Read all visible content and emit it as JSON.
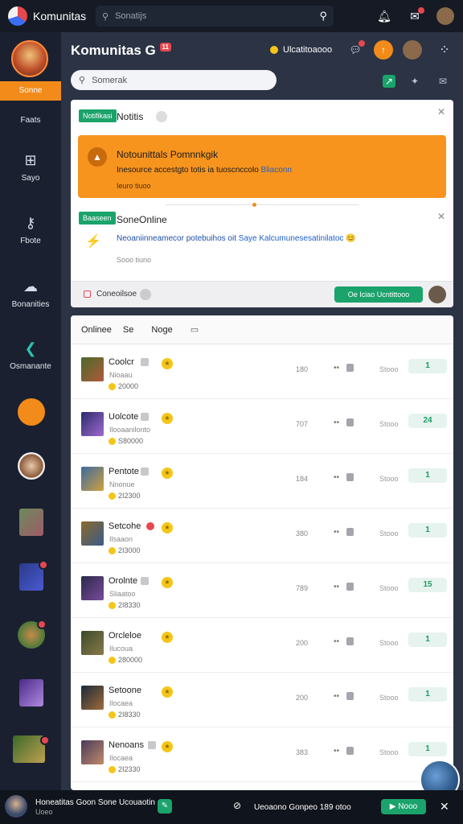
{
  "topbar": {
    "brand": "Komunitas",
    "search_placeholder": "Sonatijs"
  },
  "sidebar": {
    "items": [
      {
        "label": "Sonne"
      },
      {
        "label": "Faats"
      },
      {
        "label": "Sayo"
      },
      {
        "label": "Fbote"
      },
      {
        "label": "Bonanities"
      },
      {
        "label": "Osmanante"
      }
    ]
  },
  "header": {
    "title": "Komunitas G",
    "title_badge": "11",
    "coins_label": "Ulcatitoaooo"
  },
  "search": {
    "placeholder": "Somerak"
  },
  "notification1": {
    "tag": "Notifikasi",
    "title": "Notitis",
    "box_title": "Notounittals Pomnnkgik",
    "box_text": "Inesource accestgto totis ia tuoscnccolo",
    "box_link": "Bliaconn",
    "box_time": "Ieuro tiuoo"
  },
  "notification2": {
    "tag": "Baaseen",
    "title": "SoneOnline",
    "text": "Neoaniinneamecor potebuihos oit",
    "link": "Saye Kalcumunesesatinilatoc",
    "time": "Sooo tiuno"
  },
  "notif_footer": {
    "label": "Coneoilsoe",
    "join_label": "Oe Iciao Ucntittooo"
  },
  "table": {
    "headers": [
      "Onlinee",
      "Se",
      "Noge"
    ],
    "rows": [
      {
        "name": "Coolcr",
        "sub": "Nioaau",
        "points": "20000",
        "num": "180",
        "status": "Stooo",
        "pill": "1",
        "badge": "grey"
      },
      {
        "name": "Uolcote",
        "sub": "Ilooaanilonto",
        "points": "S80000",
        "num": "707",
        "status": "Stooo",
        "pill": "24",
        "badge": "grey"
      },
      {
        "name": "Pentote",
        "sub": "Nnonue",
        "points": "2I2300",
        "num": "184",
        "status": "Stooo",
        "pill": "1",
        "badge": "grey"
      },
      {
        "name": "Setcohe",
        "sub": "Ilsaaon",
        "points": "2I3000",
        "num": "380",
        "status": "Stooo",
        "pill": "1",
        "badge": "red"
      },
      {
        "name": "Orolnte",
        "sub": "Sliaatoo",
        "points": "2I8330",
        "num": "789",
        "status": "Stooo",
        "pill": "15",
        "badge": "grey"
      },
      {
        "name": "Orcleloe",
        "sub": "Ilucoua",
        "points": "280000",
        "num": "200",
        "status": "Stooo",
        "pill": "1",
        "badge": "grey"
      },
      {
        "name": "Setoone",
        "sub": "Ilocaea",
        "points": "2I8330",
        "num": "200",
        "status": "Stooo",
        "pill": "1",
        "badge": "grey"
      },
      {
        "name": "Nenoans",
        "sub": "Ilocaea",
        "points": "2I2330",
        "num": "383",
        "status": "Stooo",
        "pill": "1",
        "badge": "grey"
      }
    ]
  },
  "bottombar": {
    "left_text": "Honeatitas Goon Sone Ucouaotin",
    "left_sub": "Uoeo",
    "right_text": "Ueoaono Gonpeo 189 otoo",
    "button": "Nooo"
  },
  "colors": {
    "accent": "#f28b1a",
    "green": "#1aa36b",
    "sidebar": "#1a2030",
    "topbar": "#151a24"
  }
}
